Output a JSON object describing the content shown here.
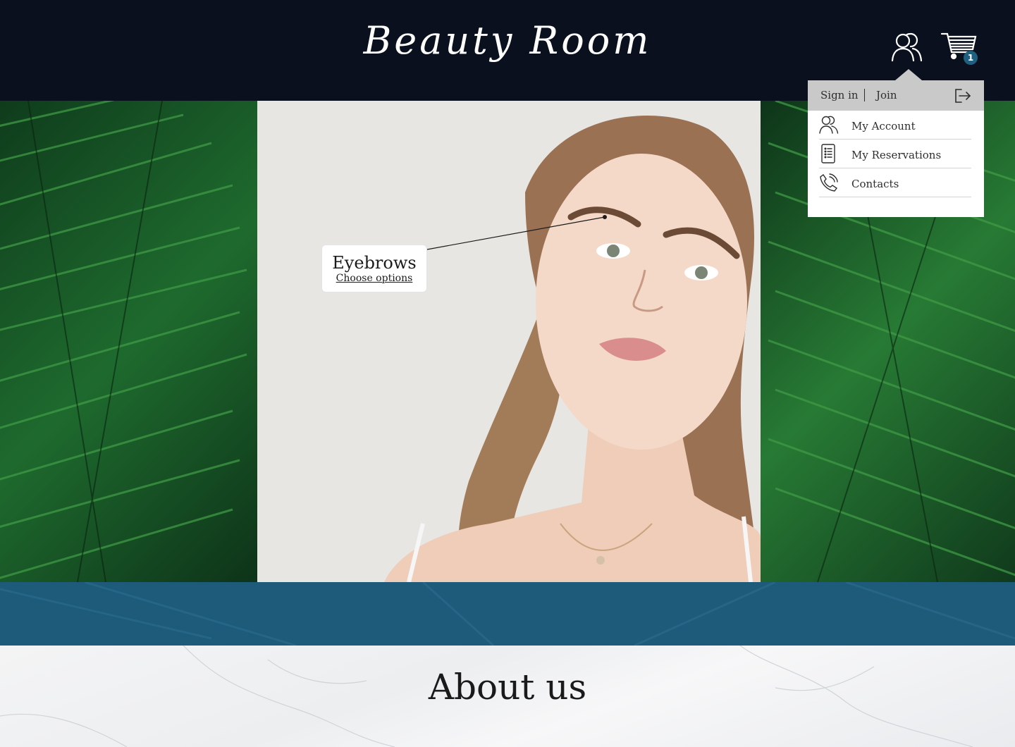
{
  "header": {
    "logo_text": "Beauty Room",
    "account_icon": "users-icon",
    "cart_icon": "cart-icon",
    "cart_count": "1"
  },
  "hero": {
    "hotspot": {
      "title": "Eyebrows",
      "link_label": "Choose options"
    }
  },
  "account_menu": {
    "sign_in_label": "Sign in",
    "join_label": "Join",
    "logout_icon": "logout-icon",
    "items": [
      {
        "label": "My Account",
        "icon": "users-icon"
      },
      {
        "label": "My Reservations",
        "icon": "list-icon"
      },
      {
        "label": "Contacts",
        "icon": "phone-icon"
      }
    ]
  },
  "about": {
    "title": "About us"
  },
  "colors": {
    "header_bg": "#0a101d",
    "band_blue": "#1e5a7a",
    "badge_blue": "#1f5f80",
    "menu_head": "#c9c9c9"
  }
}
